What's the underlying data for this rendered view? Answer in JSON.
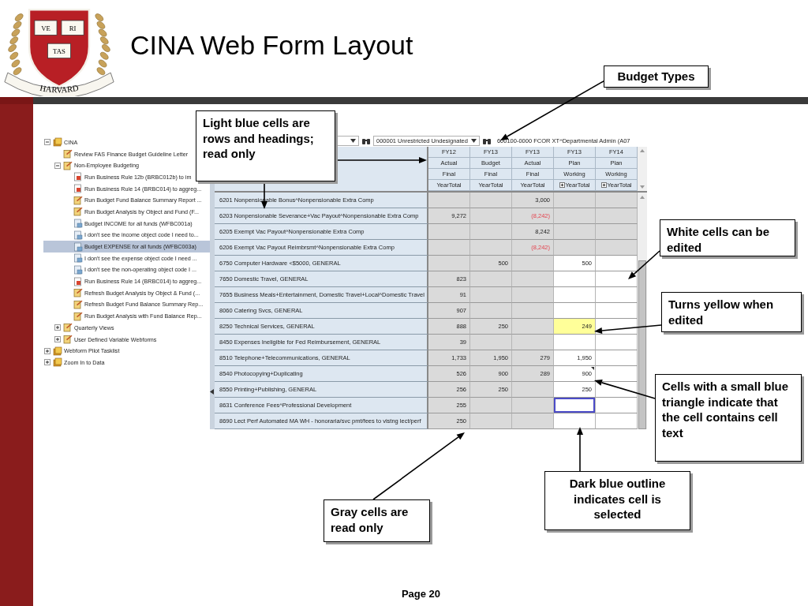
{
  "slide": {
    "title": "CINA Web Form Layout",
    "footer": "Page 20"
  },
  "logo": {
    "books": [
      "VE",
      "RI",
      "TAS"
    ],
    "ribbon": "HARVARD"
  },
  "tree": [
    {
      "label": "CINA",
      "kind": "folder",
      "expanded": true,
      "selected": false,
      "children": [
        {
          "label": "Review FAS Finance Budget Guideline Letter",
          "kind": "task",
          "selected": false
        },
        {
          "label": "Non-Employee Budgeting",
          "kind": "task",
          "expanded": true,
          "selected": false,
          "children": [
            {
              "label": "Run Business Rule 12b (BRBC012b) to im",
              "kind": "rule",
              "selected": false
            },
            {
              "label": "Run Business Rule 14 (BRBC014) to aggreg...",
              "kind": "rule",
              "selected": false
            },
            {
              "label": "Run Budget Fund Balance Summary Report ...",
              "kind": "task",
              "selected": false
            },
            {
              "label": "Run Budget Analysis by Object and Fund (F...",
              "kind": "task",
              "selected": false
            },
            {
              "label": "Budget INCOME for all funds (WFBC001a)",
              "kind": "form",
              "selected": false
            },
            {
              "label": "I don't see the income object code I need to...",
              "kind": "form",
              "selected": false
            },
            {
              "label": "Budget EXPENSE for all funds (WFBC003a)",
              "kind": "form",
              "selected": true
            },
            {
              "label": "I don't see the expense object code I need ...",
              "kind": "form",
              "selected": false
            },
            {
              "label": "I don't see the non-operating object code I ...",
              "kind": "form",
              "selected": false
            },
            {
              "label": "Run Business Rule 14 (BRBC014) to aggreg...",
              "kind": "rule",
              "selected": false
            },
            {
              "label": "Refresh Budget Analysis by Object & Fund (...",
              "kind": "task",
              "selected": false
            },
            {
              "label": "Refresh Budget Fund Balance Summary Rep...",
              "kind": "task",
              "selected": false
            },
            {
              "label": "Run Budget Analysis with Fund Balance Rep...",
              "kind": "task",
              "selected": false
            }
          ]
        },
        {
          "label": "Quarterly Views",
          "kind": "task",
          "expanded": false,
          "selected": false
        },
        {
          "label": "User Defined Variable Webforms",
          "kind": "task",
          "expanded": false,
          "selected": false
        }
      ]
    },
    {
      "label": "Webform Pilot Tasklist",
      "kind": "folder",
      "expanded": false,
      "selected": false
    },
    {
      "label": "Zoom In to Data",
      "kind": "folder",
      "expanded": false,
      "selected": false
    }
  ],
  "form": {
    "toolbar": {
      "selectors": [
        {
          "value": "000001 Unrestricted Undesignated"
        },
        {
          "value": "600100-0000 FCOR XT^Departmental Admin (A07"
        }
      ]
    },
    "columns": [
      {
        "year": "FY12",
        "scenario": "Actual",
        "version": "Final",
        "period": "YearTotal",
        "expandable": false
      },
      {
        "year": "FY13",
        "scenario": "Budget",
        "version": "Final",
        "period": "YearTotal",
        "expandable": false
      },
      {
        "year": "FY13",
        "scenario": "Actual",
        "version": "Final",
        "period": "YearTotal",
        "expandable": false
      },
      {
        "year": "FY13",
        "scenario": "Plan",
        "version": "Working",
        "period": "YearTotal",
        "expandable": true
      },
      {
        "year": "FY14",
        "scenario": "Plan",
        "version": "Working",
        "period": "YearTotal",
        "expandable": true
      }
    ],
    "rows": [
      {
        "label": "6201 Nonpensionable Bonus^Nonpensionable Extra Comp",
        "cells": [
          {
            "editable": false,
            "edited": false,
            "note": false,
            "selected": false
          },
          {
            "editable": false,
            "edited": false,
            "note": false,
            "selected": false
          },
          {
            "value": "3,000",
            "editable": false,
            "edited": false,
            "negative": false,
            "note": false,
            "selected": false
          },
          {
            "editable": false,
            "edited": false,
            "note": false,
            "selected": false
          },
          {
            "editable": false,
            "edited": false,
            "note": false,
            "selected": false
          }
        ]
      },
      {
        "label": "6203 Nonpensionable Severance+Vac Payout^Nonpensionable Extra Comp",
        "cells": [
          {
            "value": "9,272",
            "editable": false,
            "edited": false,
            "negative": false,
            "note": false,
            "selected": false
          },
          {
            "editable": false,
            "edited": false,
            "note": false,
            "selected": false
          },
          {
            "value": "(8,242)",
            "editable": false,
            "edited": false,
            "negative": true,
            "note": false,
            "selected": false
          },
          {
            "editable": false,
            "edited": false,
            "note": false,
            "selected": false
          },
          {
            "editable": false,
            "edited": false,
            "note": false,
            "selected": false
          }
        ]
      },
      {
        "label": "6205 Exempt Vac Payout^Nonpensionable Extra Comp",
        "cells": [
          {
            "editable": false,
            "edited": false,
            "note": false,
            "selected": false
          },
          {
            "editable": false,
            "edited": false,
            "note": false,
            "selected": false
          },
          {
            "value": "8,242",
            "editable": false,
            "edited": false,
            "negative": false,
            "note": false,
            "selected": false
          },
          {
            "editable": false,
            "edited": false,
            "note": false,
            "selected": false
          },
          {
            "editable": false,
            "edited": false,
            "note": false,
            "selected": false
          }
        ]
      },
      {
        "label": "6206 Exempt Vac Payout Reimbrsmt^Nonpensionable Extra Comp",
        "cells": [
          {
            "editable": false,
            "edited": false,
            "note": false,
            "selected": false
          },
          {
            "editable": false,
            "edited": false,
            "note": false,
            "selected": false
          },
          {
            "value": "(8,242)",
            "editable": false,
            "edited": false,
            "negative": true,
            "note": false,
            "selected": false
          },
          {
            "editable": false,
            "edited": false,
            "note": false,
            "selected": false
          },
          {
            "editable": false,
            "edited": false,
            "note": false,
            "selected": false
          }
        ]
      },
      {
        "label": "6750 Computer Hardware <$5000, GENERAL",
        "cells": [
          {
            "editable": false,
            "edited": false,
            "note": false,
            "selected": false
          },
          {
            "value": "500",
            "editable": false,
            "edited": false,
            "negative": false,
            "note": false,
            "selected": false
          },
          {
            "editable": false,
            "edited": false,
            "note": false,
            "selected": false
          },
          {
            "value": "500",
            "editable": true,
            "edited": false,
            "negative": false,
            "note": false,
            "selected": false
          },
          {
            "editable": true,
            "edited": false,
            "note": false,
            "selected": false
          }
        ]
      },
      {
        "label": "7650 Domestic Travel, GENERAL",
        "cells": [
          {
            "value": "823",
            "editable": false,
            "edited": false,
            "negative": false,
            "note": false,
            "selected": false
          },
          {
            "editable": false,
            "edited": false,
            "note": false,
            "selected": false
          },
          {
            "editable": false,
            "edited": false,
            "note": false,
            "selected": false
          },
          {
            "editable": true,
            "edited": false,
            "note": false,
            "selected": false
          },
          {
            "editable": true,
            "edited": false,
            "note": false,
            "selected": false
          }
        ]
      },
      {
        "label": "7655 Business Meals+Entertainment, Domestic Travel+Local^Domestic Travel",
        "cells": [
          {
            "value": "91",
            "editable": false,
            "edited": false,
            "negative": false,
            "note": false,
            "selected": false
          },
          {
            "editable": false,
            "edited": false,
            "note": false,
            "selected": false
          },
          {
            "editable": false,
            "edited": false,
            "note": false,
            "selected": false
          },
          {
            "editable": true,
            "edited": false,
            "note": false,
            "selected": false
          },
          {
            "editable": true,
            "edited": false,
            "note": false,
            "selected": false
          }
        ]
      },
      {
        "label": "8060 Catering Svcs, GENERAL",
        "cells": [
          {
            "value": "907",
            "editable": false,
            "edited": false,
            "negative": false,
            "note": false,
            "selected": false
          },
          {
            "editable": false,
            "edited": false,
            "note": false,
            "selected": false
          },
          {
            "editable": false,
            "edited": false,
            "note": false,
            "selected": false
          },
          {
            "editable": true,
            "edited": false,
            "note": false,
            "selected": false
          },
          {
            "editable": true,
            "edited": false,
            "note": false,
            "selected": false
          }
        ]
      },
      {
        "label": "8250 Technical Services, GENERAL",
        "cells": [
          {
            "value": "888",
            "editable": false,
            "edited": false,
            "negative": false,
            "note": false,
            "selected": false
          },
          {
            "value": "250",
            "editable": false,
            "edited": false,
            "negative": false,
            "note": false,
            "selected": false
          },
          {
            "editable": false,
            "edited": false,
            "note": false,
            "selected": false
          },
          {
            "value": "249",
            "editable": true,
            "edited": true,
            "negative": false,
            "note": false,
            "selected": false
          },
          {
            "editable": true,
            "edited": false,
            "note": false,
            "selected": false
          }
        ]
      },
      {
        "label": "8450 Expenses Ineligible for Fed Reimbursement, GENERAL",
        "cells": [
          {
            "value": "39",
            "editable": false,
            "edited": false,
            "negative": false,
            "note": false,
            "selected": false
          },
          {
            "editable": false,
            "edited": false,
            "note": false,
            "selected": false
          },
          {
            "editable": false,
            "edited": false,
            "note": false,
            "selected": false
          },
          {
            "editable": true,
            "edited": false,
            "note": false,
            "selected": false
          },
          {
            "editable": true,
            "edited": false,
            "note": false,
            "selected": false
          }
        ]
      },
      {
        "label": "8510 Telephone+Telecommunications, GENERAL",
        "cells": [
          {
            "value": "1,733",
            "editable": false,
            "edited": false,
            "negative": false,
            "note": false,
            "selected": false
          },
          {
            "value": "1,950",
            "editable": false,
            "edited": false,
            "negative": false,
            "note": false,
            "selected": false
          },
          {
            "value": "279",
            "editable": false,
            "edited": false,
            "negative": false,
            "note": false,
            "selected": false
          },
          {
            "value": "1,950",
            "editable": true,
            "edited": false,
            "negative": false,
            "note": false,
            "selected": false
          },
          {
            "editable": true,
            "edited": false,
            "note": false,
            "selected": false
          }
        ]
      },
      {
        "label": "8540 Photocopying+Duplicating",
        "cells": [
          {
            "value": "526",
            "editable": false,
            "edited": false,
            "negative": false,
            "note": false,
            "selected": false
          },
          {
            "value": "900",
            "editable": false,
            "edited": false,
            "negative": false,
            "note": false,
            "selected": false
          },
          {
            "value": "289",
            "editable": false,
            "edited": false,
            "negative": false,
            "note": false,
            "selected": false
          },
          {
            "value": "900",
            "editable": true,
            "edited": false,
            "negative": false,
            "note": true,
            "selected": false
          },
          {
            "editable": true,
            "edited": false,
            "note": false,
            "selected": false
          }
        ]
      },
      {
        "label": "8550 Printing+Publishing, GENERAL",
        "cells": [
          {
            "value": "256",
            "editable": false,
            "edited": false,
            "negative": false,
            "note": false,
            "selected": false
          },
          {
            "value": "250",
            "editable": false,
            "edited": false,
            "negative": false,
            "note": false,
            "selected": false
          },
          {
            "editable": false,
            "edited": false,
            "note": false,
            "selected": false
          },
          {
            "value": "250",
            "editable": true,
            "edited": false,
            "negative": false,
            "note": false,
            "selected": false
          },
          {
            "editable": true,
            "edited": false,
            "note": false,
            "selected": false
          }
        ]
      },
      {
        "label": "8631 Conference Fees^Professional Development",
        "cells": [
          {
            "value": "255",
            "editable": false,
            "edited": false,
            "negative": false,
            "note": false,
            "selected": false
          },
          {
            "editable": false,
            "edited": false,
            "note": false,
            "selected": false
          },
          {
            "editable": false,
            "edited": false,
            "note": false,
            "selected": false
          },
          {
            "editable": true,
            "edited": false,
            "note": false,
            "selected": true
          },
          {
            "editable": true,
            "edited": false,
            "note": false,
            "selected": false
          }
        ]
      },
      {
        "label": "8690 Lect Perf Automated MA WH - honoraria/svc pmt/fees to vistng lect/perf",
        "cells": [
          {
            "value": "250",
            "editable": false,
            "edited": false,
            "negative": false,
            "note": false,
            "selected": false
          },
          {
            "editable": false,
            "edited": false,
            "note": false,
            "selected": false
          },
          {
            "editable": false,
            "edited": false,
            "note": false,
            "selected": false
          },
          {
            "editable": true,
            "edited": false,
            "note": false,
            "selected": false
          },
          {
            "editable": true,
            "edited": false,
            "note": false,
            "selected": false
          }
        ]
      }
    ]
  },
  "callouts": [
    {
      "text": "Budget Types"
    },
    {
      "text": "Light blue cells are rows and headings; read only"
    },
    {
      "text": "White cells can be edited"
    },
    {
      "text": "Turns yellow when edited"
    },
    {
      "text": "Cells with a small blue triangle indicate that the cell contains cell text"
    },
    {
      "text": "Dark blue outline indicates cell is selected"
    },
    {
      "text": "Gray cells are read only"
    }
  ]
}
